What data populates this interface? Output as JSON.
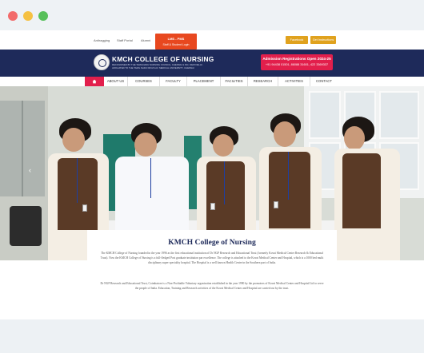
{
  "window": {
    "controls": [
      "close",
      "minimize",
      "maximize"
    ]
  },
  "topbar": {
    "links": [
      "Antiragging",
      "Staff Portal",
      "Alumni"
    ],
    "lms": {
      "line1": "LMS - PMS",
      "line2": "Staff & Student Login"
    },
    "buttons": [
      "Facebook",
      "Get Instructions"
    ]
  },
  "header": {
    "college_name": "KMCH COLLEGE OF NURSING",
    "subline": "RECOGNISED BY THE TAMILNADU NURSING COUNCIL, CHENNAI & INC, NEW DELHI · AFFILIATED TO THE TAMIL NADU DR.M.G.R. MEDICAL UNIVERSITY, CHENNAI",
    "admission": {
      "title": "Admission Registrations Open 2024-25",
      "phones": "+91 94438 01501, 86088 31601, 422 3369337"
    }
  },
  "nav": {
    "items": [
      "ABOUT US",
      "COURSES",
      "FACULTY",
      "PLACEMENT",
      "FACILITIES",
      "RESEARCH",
      "ACTIVITIES",
      "CONTACT"
    ]
  },
  "hero": {
    "prev_arrow": "‹"
  },
  "card": {
    "title": "KMCH College of Nursing",
    "para1": "The KMCH College of Nursing founded in the year 1996 as the first educational institution of Dr NGP Research and Educational Trust (formerly Kovai Medical Center Research & Educational Trust). Now the KMCH College of Nursing is a full-fledged Post graduate institution par excellence. The college is attached to the Kovai Medical Center and Hospital, which is a 1000 bed multi disciplinary super speciality hospital. The Hospital is a well known Health Centre in the Southern part of India.",
    "para2": "Dr NGP Research and Educational Trust, Coimbatore is a Non-Profitable Voluntary organisation established in the year 1990 by the promoters of Kovai Medical Center and Hospital Ltd to serve the people of India. Education, Training and Research activities of the Kovai Medical Center and Hospital are carried out by the trust."
  },
  "colors": {
    "navy": "#1e2a5a",
    "accent_red": "#e21f4c",
    "orange": "#e8481f",
    "gold": "#e0a21e"
  }
}
